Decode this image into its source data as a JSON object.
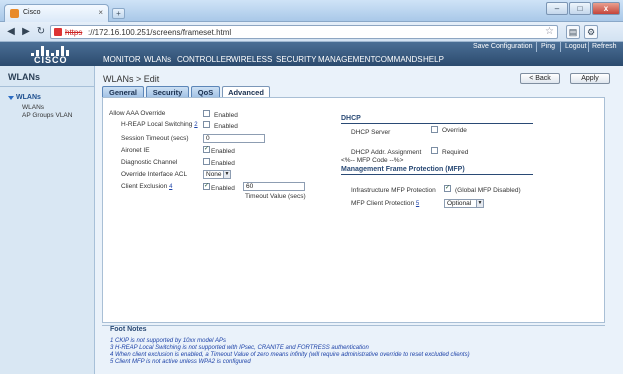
{
  "browser": {
    "tab_title": "Cisco",
    "tab_close": "×",
    "new_tab": "+",
    "url_scheme": "https",
    "url_rest": "://172.16.100.251/screens/frameset.html",
    "minimize_glyph": "–",
    "maximize_glyph": "□",
    "close_glyph": "x",
    "icons": [
      "back-icon",
      "forward-icon",
      "reload-icon",
      "lock-icon",
      "star-icon",
      "page-icon",
      "tools-icon"
    ]
  },
  "header": {
    "logo_text": "CISCO",
    "menu": [
      "MONITOR",
      "WLANs",
      "CONTROLLER",
      "WIRELESS",
      "SECURITY",
      "MANAGEMENT",
      "COMMANDS",
      "HELP"
    ],
    "util": [
      "Save Configuration",
      "Ping",
      "Logout",
      "Refresh"
    ]
  },
  "leftnav": {
    "title": "WLANs",
    "head": "WLANs",
    "items": [
      "WLANs",
      "AP Groups VLAN"
    ]
  },
  "content": {
    "title": "WLANs > Edit",
    "back_button": "< Back",
    "apply_button": "Apply",
    "tabs": [
      "General",
      "Security",
      "QoS",
      "Advanced"
    ],
    "active_tab": "Advanced",
    "left": {
      "allow_aaa_label": "Allow AAA Override",
      "allow_aaa_value": "Enabled",
      "hreap_label": "H-REAP Local Switching",
      "hreap_ref": "2",
      "hreap_value": "Enabled",
      "session_timeout_label": "Session Timeout (secs)",
      "session_timeout_value": "0",
      "aironet_label": "Aironet IE",
      "aironet_value": "Enabled",
      "diag_label": "Diagnostic Channel",
      "diag_value": "Enabled",
      "override_acl_label": "Override Interface ACL",
      "override_acl_value": "None",
      "client_excl_label": "Client Exclusion",
      "client_excl_ref": "4",
      "client_excl_value": "Enabled",
      "client_excl_timeout": "60",
      "client_excl_timeout_label": "Timeout Value (secs)"
    },
    "right": {
      "dhcp_head": "DHCP",
      "dhcp_server_label": "DHCP Server",
      "dhcp_server_value": "Override",
      "dhcp_assign_label": "DHCP Addr. Assignment",
      "dhcp_assign_value": "Required",
      "mfp_code": "<%-- MFP Code --%>",
      "mfp_head": "Management Frame Protection (MFP)",
      "infra_mfp_label": "Infrastructure MFP Protection",
      "infra_mfp_value": "(Global MFP Disabled)",
      "client_mfp_label": "MFP Client Protection",
      "client_mfp_ref": "5",
      "client_mfp_value": "Optional"
    },
    "footnotes_title": "Foot Notes",
    "footnotes": [
      "1 CKIP is not supported by 10xx model APs",
      "3 H-REAP Local Switching is not supported with IPsec, CRANITE and FORTRESS authentication",
      "4 When client exclusion is enabled, a Timeout Value of zero means infinity (will require administrative override to reset excluded clients)",
      "5 Client MFP is not active unless WPA2 is configured"
    ]
  }
}
